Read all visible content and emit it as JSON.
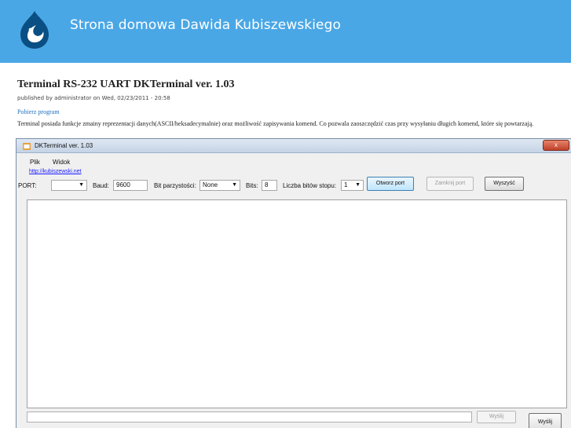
{
  "site": {
    "title": "Strona domowa Dawida Kubiszewskiego"
  },
  "article": {
    "title": "Terminal RS-232 UART DKTerminal ver. 1.03",
    "submitted": "published by administrator on Wed, 02/23/2011 - 20:58",
    "download_link": "Pobierz program",
    "description": "Terminal posiada funkcje zmainy reprezentacji danych(ASCII/heksadecymalnie) oraz możliwość zapisywania komend. Co pozwala zaoszczędzić czas przy wysyłaniu długich komend, które się powtarzają."
  },
  "app": {
    "window_title": "DKTerminal ver. 1.03",
    "close_label": "x",
    "menu": [
      "Plik",
      "Widok"
    ],
    "link": "http://kubiszewski.net",
    "toolbar": {
      "port_label": "PORT:",
      "port_value": "",
      "baud_label": "Baud:",
      "baud_value": "9600",
      "parity_label": "Bit parzystości:",
      "parity_value": "None",
      "bits_label": "Bits:",
      "bits_value": "8",
      "stopbits_label": "Liczba bitów stopu:",
      "stopbits_value": "1",
      "open_port": "Otworz port",
      "close_port": "Zamknij port",
      "clear": "Wyszyść"
    },
    "send_label": "Wyślij",
    "send2_label": "Wyślij"
  },
  "colors": {
    "header_bg": "#4aa7e6",
    "link": "#1f6fbf"
  },
  "icons": {
    "logo": "drupal-drop-icon",
    "app": "window-app-icon",
    "dropdown": "chevron-down-icon"
  }
}
